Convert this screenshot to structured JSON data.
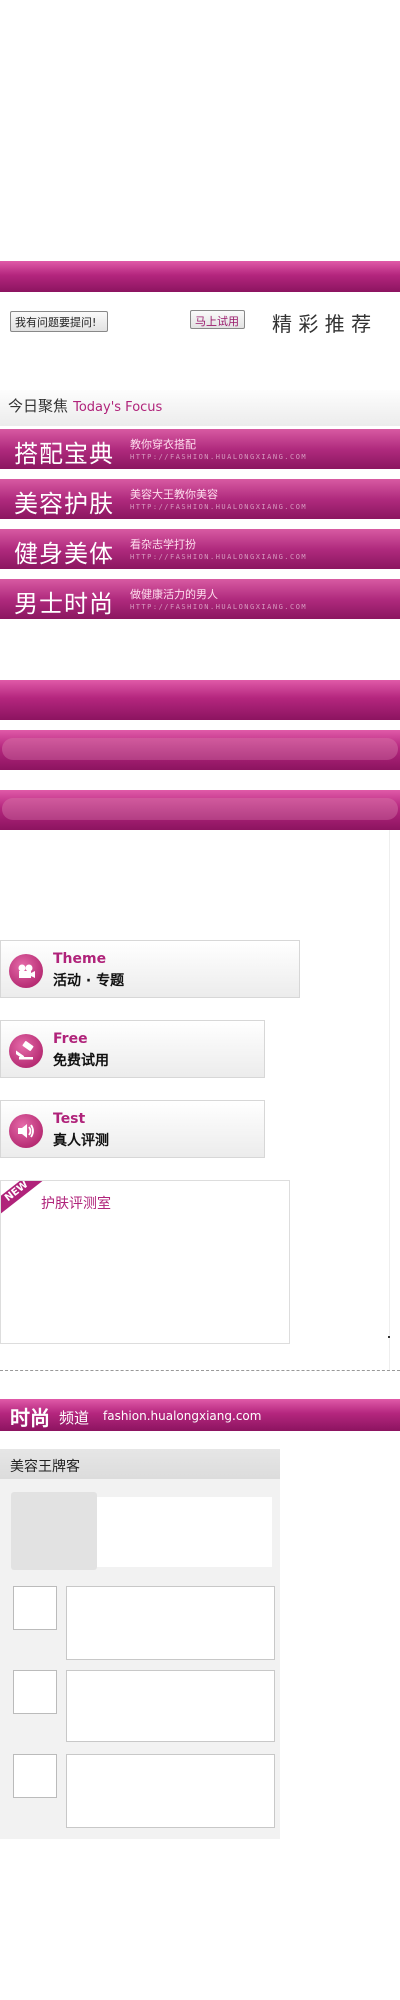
{
  "top_bar": {
    "color": "#a62275"
  },
  "buttons": {
    "ask": "我有问题要提问!",
    "try": "马上试用"
  },
  "recommend_title": "精 彩 推 荐",
  "focus": {
    "title_cn": "今日聚焦",
    "title_en": "Today's Focus"
  },
  "nav_items": [
    {
      "title": "搭配宝典",
      "sub": "教你穿衣搭配",
      "url": "HTTP://FASHION.HUALONGXIANG.COM"
    },
    {
      "title": "美容护肤",
      "sub": "美容大王教你美容",
      "url": "HTTP://FASHION.HUALONGXIANG.COM"
    },
    {
      "title": "健身美体",
      "sub": "看杂志学打扮",
      "url": "HTTP://FASHION.HUALONGXIANG.COM"
    },
    {
      "title": "男士时尚",
      "sub": "做健康活力的男人",
      "url": "HTTP://FASHION.HUALONGXIANG.COM"
    }
  ],
  "cards": [
    {
      "en": "Theme",
      "cn": "活动 · 专题",
      "icon": "camera-icon"
    },
    {
      "en": "Free",
      "cn": "免费试用",
      "icon": "gavel-icon"
    },
    {
      "en": "Test",
      "cn": "真人评测",
      "icon": "speaker-icon"
    }
  ],
  "lab": {
    "badge": "NEW",
    "title": "护肤评测室"
  },
  "channel": {
    "title": "时尚",
    "sub": "频道",
    "url": "fashion.hualongxiang.com"
  },
  "blog": {
    "title": "美容王牌客"
  }
}
